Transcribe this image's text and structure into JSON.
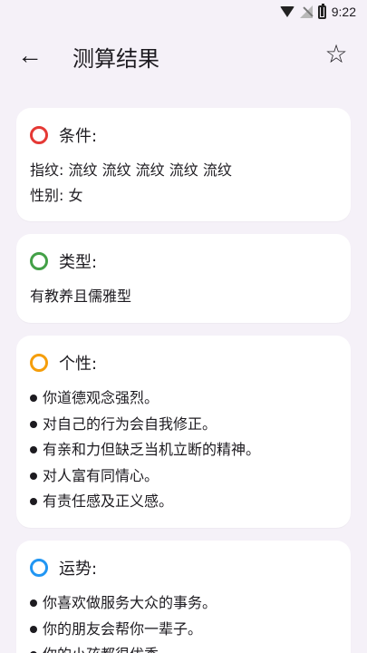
{
  "status": {
    "time": "9:22"
  },
  "app_bar": {
    "title": "测算结果"
  },
  "conditions": {
    "title": "条件:",
    "fingerprint": "指纹: 流纹 流纹 流纹 流纹 流纹",
    "gender": "性别: 女",
    "color": "#e53935"
  },
  "type": {
    "title": "类型:",
    "text": "有教养且儒雅型",
    "color": "#43a047"
  },
  "personality": {
    "title": "个性:",
    "color": "#f59e0b",
    "items": [
      "你道德观念强烈。",
      "对自己的行为会自我修正。",
      "有亲和力但缺乏当机立断的精神。",
      "对人富有同情心。",
      "有责任感及正义感。"
    ]
  },
  "fortune": {
    "title": "运势:",
    "color": "#2196f3",
    "items": [
      "你喜欢做服务大众的事务。",
      "你的朋友会帮你一辈子。",
      "你的小孩都很优秀。"
    ]
  }
}
